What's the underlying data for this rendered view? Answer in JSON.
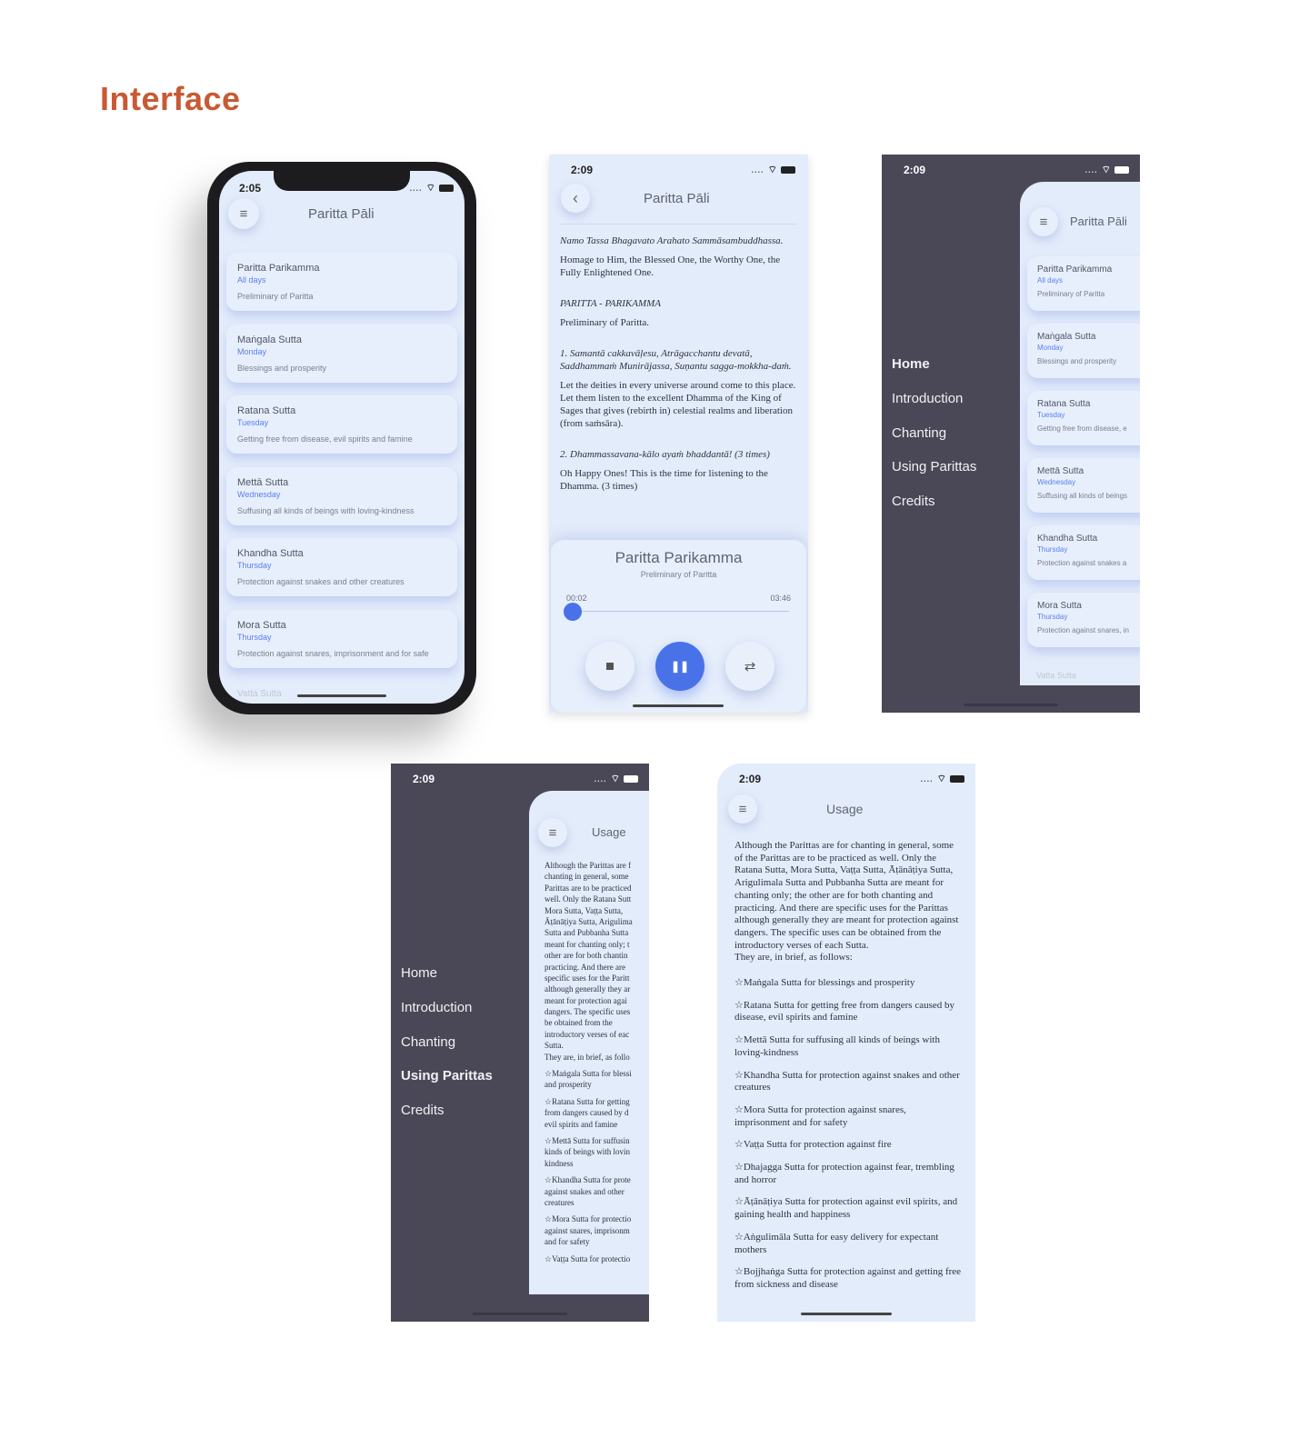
{
  "heading": "Interface",
  "home": {
    "time": "2:05",
    "title": "Paritta Pāli",
    "cards": [
      {
        "name": "Paritta Parikamma",
        "day": "All days",
        "desc": "Preliminary of Paritta"
      },
      {
        "name": "Maṅgala Sutta",
        "day": "Monday",
        "desc": "Blessings and prosperity"
      },
      {
        "name": "Ratana Sutta",
        "day": "Tuesday",
        "desc": "Getting free from disease, evil spirits and famine"
      },
      {
        "name": "Mettā Sutta",
        "day": "Wednesday",
        "desc": "Suffusing all kinds of beings with loving-kindness"
      },
      {
        "name": "Khandha Sutta",
        "day": "Thursday",
        "desc": "Protection against snakes and other creatures"
      },
      {
        "name": "Mora Sutta",
        "day": "Thursday",
        "desc": "Protection against snares, imprisonment and for safe"
      }
    ],
    "faded": "Vatta Sutta"
  },
  "player": {
    "time": "2:09",
    "title": "Paritta Pāli",
    "paras": [
      {
        "t": "Namo Tassa Bhagavato Arahato Sammāsambuddhassa.",
        "i": true
      },
      {
        "t": "Homage to Him, the Blessed One, the Worthy One, the Fully Enlightened One.",
        "i": false
      },
      {
        "t": "PARITTA - PARIKAMMA",
        "i": true
      },
      {
        "t": "Preliminary of Paritta.",
        "i": false
      },
      {
        "t": "1. Samantā cakkavāḷesu, Atrāgacchantu devatā, Saddhammaṁ Munirājassa, Suṇantu sagga-mokkha-daṁ.",
        "i": true
      },
      {
        "t": "Let the deities in every universe around come to this place. Let them listen to the excellent Dhamma of the King of Sages that gives (rebirth in) celestial realms and liberation (from saṁsāra).",
        "i": false
      },
      {
        "t": "2. Dhammassavana-kālo ayaṁ bhaddantā! (3 times)",
        "i": true
      },
      {
        "t": "Oh Happy Ones! This is the time for listening to the Dhamma. (3 times)",
        "i": false
      }
    ],
    "track": "Paritta Parikamma",
    "subtitle": "Preliminary of Paritta",
    "elapsed": "00:02",
    "total": "03:46",
    "progress": 0.01
  },
  "drawer1": {
    "time": "2:09",
    "title": "Paritta Pāli",
    "nav": [
      "Home",
      "Introduction",
      "Chanting",
      "Using Parittas",
      "Credits"
    ],
    "active": 0,
    "cards": [
      {
        "name": "Paritta Parikamma",
        "day": "All days",
        "desc": "Preliminary of Paritta"
      },
      {
        "name": "Maṅgala Sutta",
        "day": "Monday",
        "desc": "Blessings and prosperity"
      },
      {
        "name": "Ratana Sutta",
        "day": "Tuesday",
        "desc": "Getting free from disease, e"
      },
      {
        "name": "Mettā Sutta",
        "day": "Wednesday",
        "desc": "Suffusing all kinds of beings"
      },
      {
        "name": "Khandha Sutta",
        "day": "Thursday",
        "desc": "Protection against snakes a"
      },
      {
        "name": "Mora Sutta",
        "day": "Thursday",
        "desc": "Protection against snares, in"
      }
    ],
    "faded": "Vatta Sutta"
  },
  "drawer2": {
    "time": "2:09",
    "title": "Usage",
    "nav": [
      "Home",
      "Introduction",
      "Chanting",
      "Using Parittas",
      "Credits"
    ],
    "active": 3,
    "lines": [
      "Although the Parittas are f",
      "chanting in general, some",
      "Parittas are to be practiced",
      "well. Only the Ratana Sutt",
      "Mora Sutta, Vaṭṭa Sutta,",
      "Āṭānāṭiya Sutta, Arigulima",
      "Sutta and Pubbanha Sutta",
      "meant for chanting only; t",
      "other are for both chantin",
      "practicing. And there are",
      "specific uses for the Paritt",
      "although generally they ar",
      "meant for protection agai",
      "dangers. The specific uses",
      "be obtained from the",
      "introductory verses of eac",
      "Sutta.",
      "They are, in brief, as follo",
      "",
      "☆Maṅgala Sutta for blessi",
      "and prosperity",
      "",
      "☆Ratana Sutta for getting",
      "from dangers caused by d",
      "evil spirits and famine",
      "",
      "☆Mettā Sutta for suffusin",
      "kinds of beings with lovin",
      "kindness",
      "",
      "☆Khandha Sutta for prote",
      "against snakes and other",
      "creatures",
      "",
      "☆Mora Sutta for protectio",
      "against snares, imprisonm",
      "and for safety",
      "",
      "☆Vaṭṭa Sutta for protectio"
    ]
  },
  "usage": {
    "time": "2:09",
    "title": "Usage",
    "intro": "Although the Parittas are for chanting in general, some of the Parittas are to be practiced as well. Only the Ratana Sutta, Mora Sutta, Vaṭṭa Sutta, Āṭānāṭiya Sutta, Arigulimala Sutta and Pubbanha Sutta are meant for chanting only; the other are for both chanting and practicing. And there are specific uses for the Parittas although generally they are meant for protection against dangers. The specific uses can be obtained from the introductory verses of each Sutta.",
    "intro2": "They are, in brief, as follows:",
    "items": [
      "☆Maṅgala Sutta for blessings and prosperity",
      "☆Ratana Sutta for getting free from dangers caused by disease, evil spirits and famine",
      "☆Mettā Sutta for suffusing all kinds of beings with loving-kindness",
      "☆Khandha Sutta for protection against snakes and other creatures",
      "☆Mora Sutta for protection against snares, imprisonment and for safety",
      "☆Vaṭṭa Sutta for protection against fire",
      "☆Dhajagga Sutta for protection against fear, trembling and horror",
      "☆Āṭānāṭiya Sutta for protection against evil spirits, and gaining health and happiness",
      "☆Aṅgulimāla Sutta for easy delivery for expectant mothers",
      "☆Bojjhaṅga Sutta for protection against and getting free from sickness and disease"
    ]
  },
  "colors": {
    "accent": "#c85a33",
    "blue": "#5a7ef0",
    "bg": "#e3ecfb",
    "drawer": "#4a4857"
  }
}
